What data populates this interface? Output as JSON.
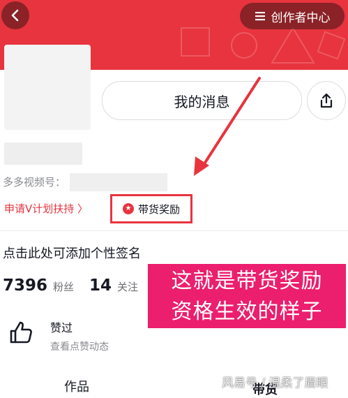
{
  "header": {
    "creator_center_label": "创作者中心"
  },
  "profile": {
    "my_messages_label": "我的消息",
    "id_label": "多多视频号：",
    "v_plan_label": "申请V计划扶持 〉",
    "sales_reward_label": "带货奖励",
    "bio_placeholder": "点击此处可添加个性签名",
    "fans_count": "7396",
    "fans_label": "粉丝",
    "following_count": "14",
    "following_label": "关注"
  },
  "likes": {
    "title": "赞过",
    "subtitle": "查看点赞动态"
  },
  "tabs": [
    {
      "label": "作品"
    },
    {
      "label": "带货"
    }
  ],
  "annotation": {
    "line1": "这就是带货奖励",
    "line2": "资格生效的样子"
  },
  "watermark": "风易号 / 温柔了眉眼",
  "colors": {
    "brand_red": "#e8343e",
    "annotation_pink": "#ec1e6e",
    "arrow_red": "#e8343e"
  }
}
